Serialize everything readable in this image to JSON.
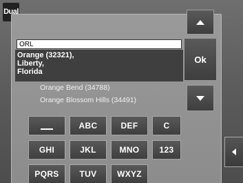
{
  "app": {
    "logo_text": "Dual"
  },
  "search": {
    "value": "ORL"
  },
  "results": {
    "selected_lines": [
      "Orange (32321),",
      "Liberty,",
      "Florida"
    ],
    "items": [
      {
        "label": "Orange Bend (34788)"
      },
      {
        "label": "Orange Blossom Hills (34491)"
      }
    ]
  },
  "buttons": {
    "ok_label": "Ok",
    "scroll_up_icon": "triangle-up-icon",
    "scroll_down_icon": "triangle-down-icon",
    "side_tab_icon": "triangle-left-icon"
  },
  "keypad": {
    "row1": [
      "_",
      "ABC",
      "DEF",
      "C"
    ],
    "row2": [
      "GHI",
      "JKL",
      "MNO",
      "123"
    ],
    "row3": [
      "PQRS",
      "TUV",
      "WXYZ"
    ]
  }
}
